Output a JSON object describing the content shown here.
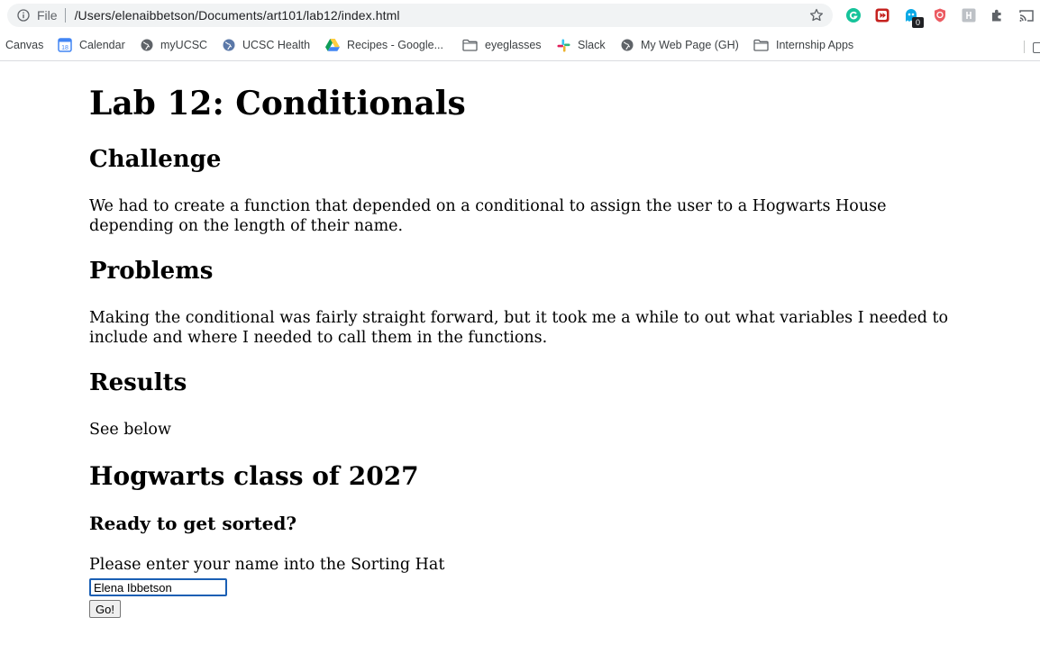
{
  "browser": {
    "scheme": "File",
    "url": "/Users/elenaibbetson/Documents/art101/lab12/index.html",
    "extension_badge": "0",
    "bookmarks": [
      {
        "label": "Canvas",
        "icon": "none"
      },
      {
        "label": "Calendar",
        "icon": "calendar-icon"
      },
      {
        "label": "myUCSC",
        "icon": "globe-icon"
      },
      {
        "label": "UCSC Health",
        "icon": "globe-icon"
      },
      {
        "label": "Recipes - Google...",
        "icon": "google-drive-icon"
      },
      {
        "label": "eyeglasses",
        "icon": "folder-icon"
      },
      {
        "label": "Slack",
        "icon": "slack-icon"
      },
      {
        "label": "My Web Page (GH)",
        "icon": "globe-icon"
      },
      {
        "label": "Internship Apps",
        "icon": "folder-icon"
      }
    ]
  },
  "page": {
    "title": "Lab 12: Conditionals",
    "sections": [
      {
        "heading": "Challenge",
        "body": "We had to create a function that depended on a conditional to assign the user to a Hogwarts House depending on the length of their name."
      },
      {
        "heading": "Problems",
        "body": "Making the conditional was fairly straight forward, but it took me a while to out what variables I needed to include and where I needed to call them in the functions."
      },
      {
        "heading": "Results",
        "body": "See below"
      }
    ],
    "app": {
      "heading": "Hogwarts class of 2027",
      "subheading": "Ready to get sorted?",
      "prompt": "Please enter your name into the Sorting Hat",
      "input_value": "Elena Ibbetson",
      "button_label": "Go!"
    }
  }
}
